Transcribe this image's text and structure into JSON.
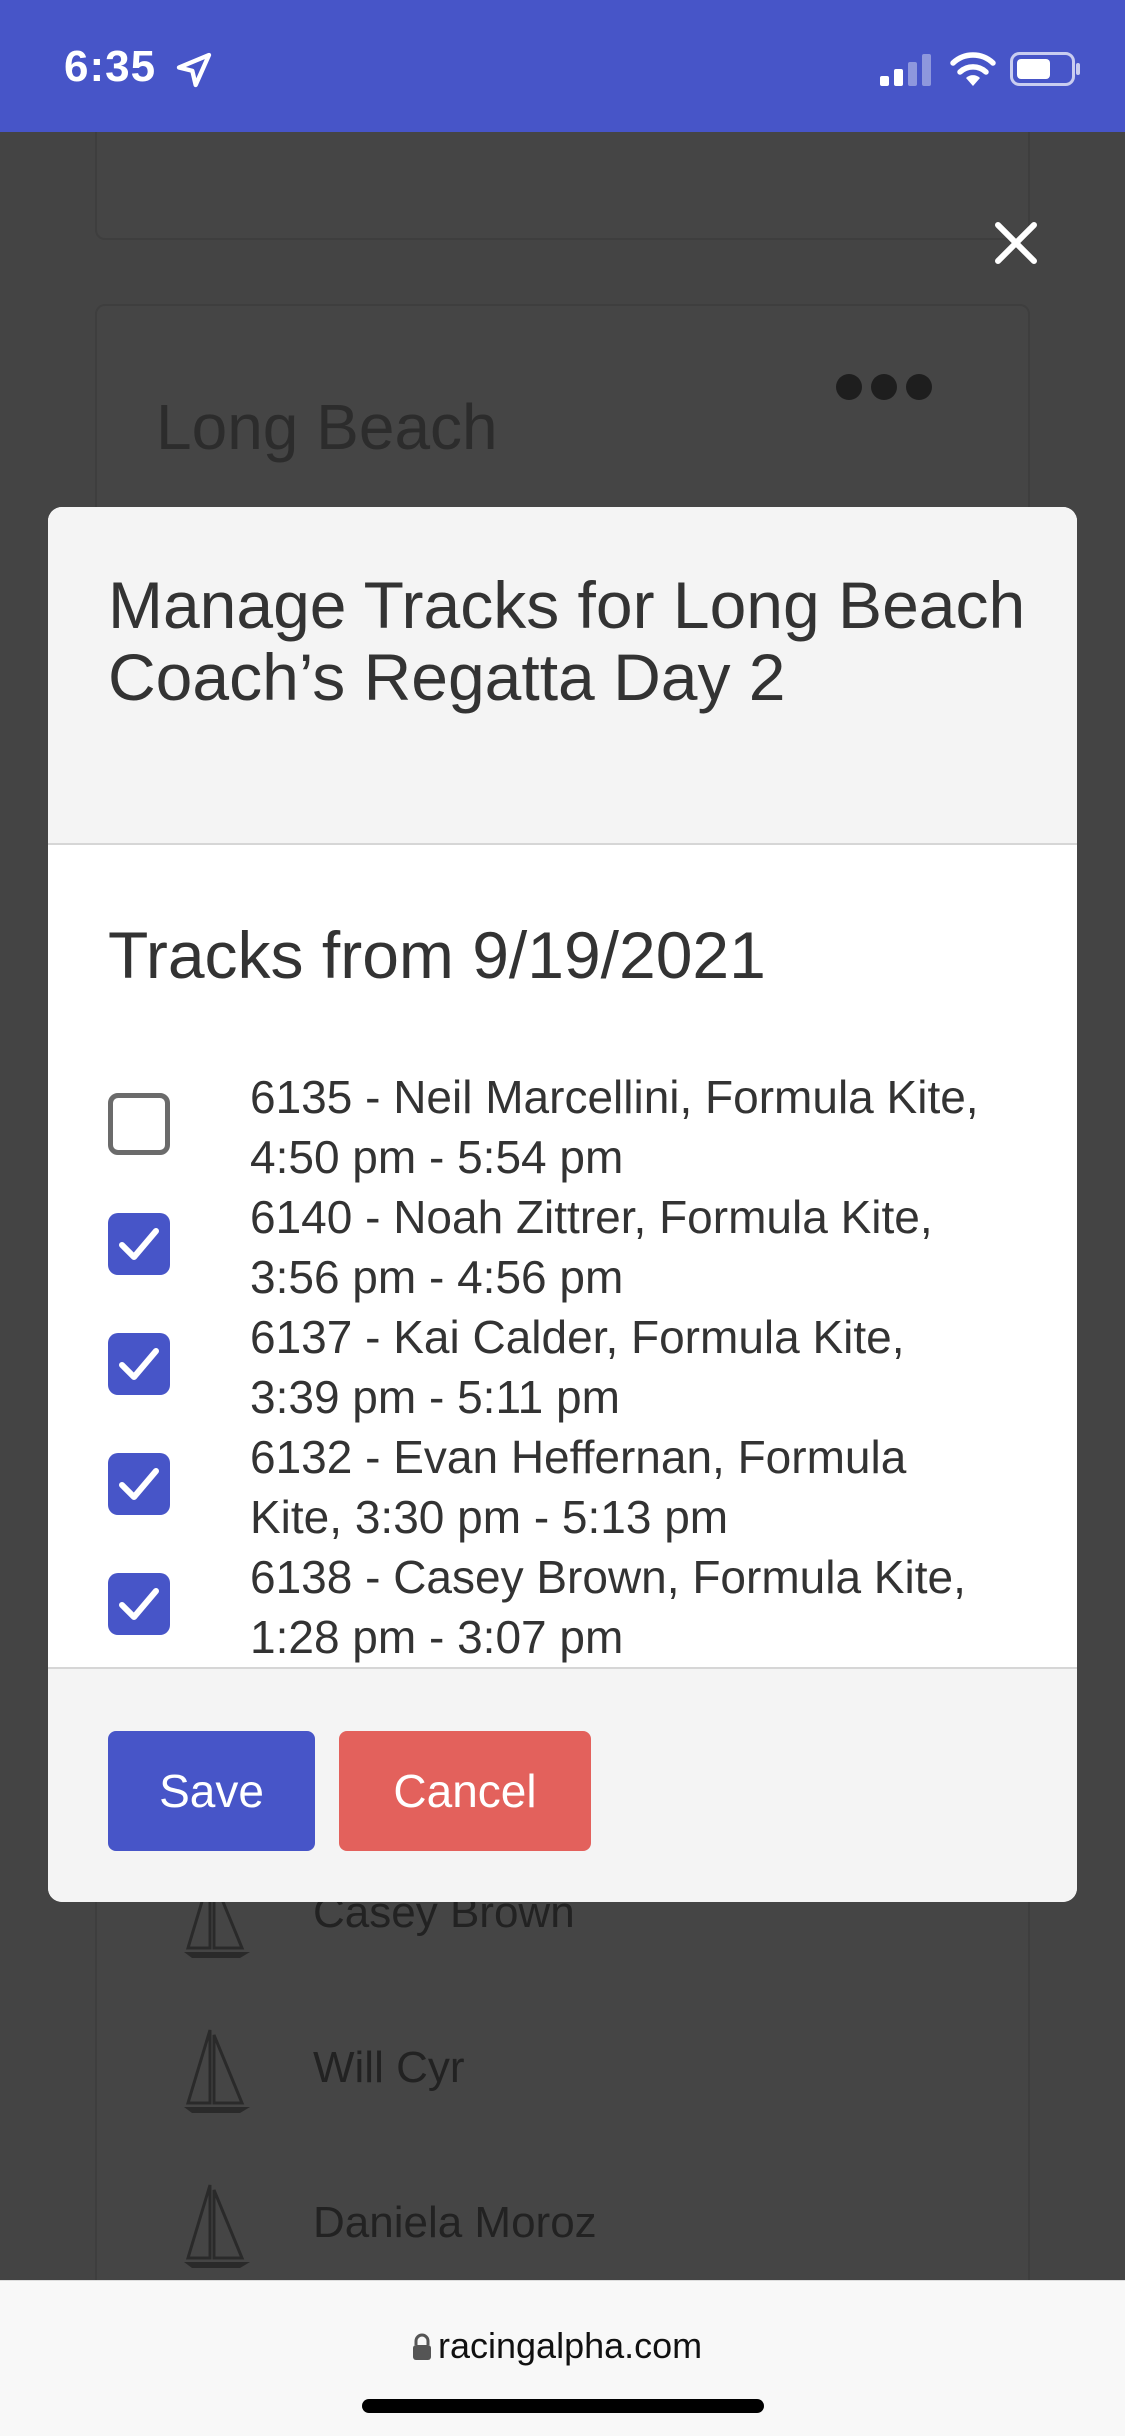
{
  "status_bar": {
    "time": "6:35",
    "bg_color": "#4755c8"
  },
  "background": {
    "title_line1": "Long Beach",
    "people": [
      "Casey Brown",
      "Will Cyr",
      "Daniela Moroz"
    ]
  },
  "modal": {
    "title": "Manage Tracks for Long Beach Coach’s Regatta Day 2",
    "section_title": "Tracks from 9/19/2021",
    "tracks": [
      {
        "line1": "6135 - Neil Marcellini, Formula Kite,",
        "line2": "4:50 pm - 5:54 pm",
        "checked": false
      },
      {
        "line1": "6140 - Noah Zittrer, Formula Kite,",
        "line2": "3:56 pm - 4:56 pm",
        "checked": true
      },
      {
        "line1": "6137 - Kai Calder, Formula Kite,",
        "line2": "3:39 pm - 5:11 pm",
        "checked": true
      },
      {
        "line1": "6132 - Evan Heffernan, Formula",
        "line2": "Kite, 3:30 pm - 5:13 pm",
        "checked": true
      },
      {
        "line1": "6138 - Casey Brown, Formula Kite,",
        "line2": "1:28 pm - 3:07 pm",
        "checked": true
      }
    ],
    "save_label": "Save",
    "cancel_label": "Cancel",
    "save_color": "#4755c8",
    "cancel_color": "#e3615c"
  },
  "url_bar": {
    "url": "racingalpha.com"
  },
  "icons": [
    "location-arrow-icon",
    "signal-icon",
    "wifi-icon",
    "battery-icon",
    "close-icon",
    "more-icon",
    "sailboat-icon",
    "checkmark-icon",
    "lock-icon"
  ]
}
